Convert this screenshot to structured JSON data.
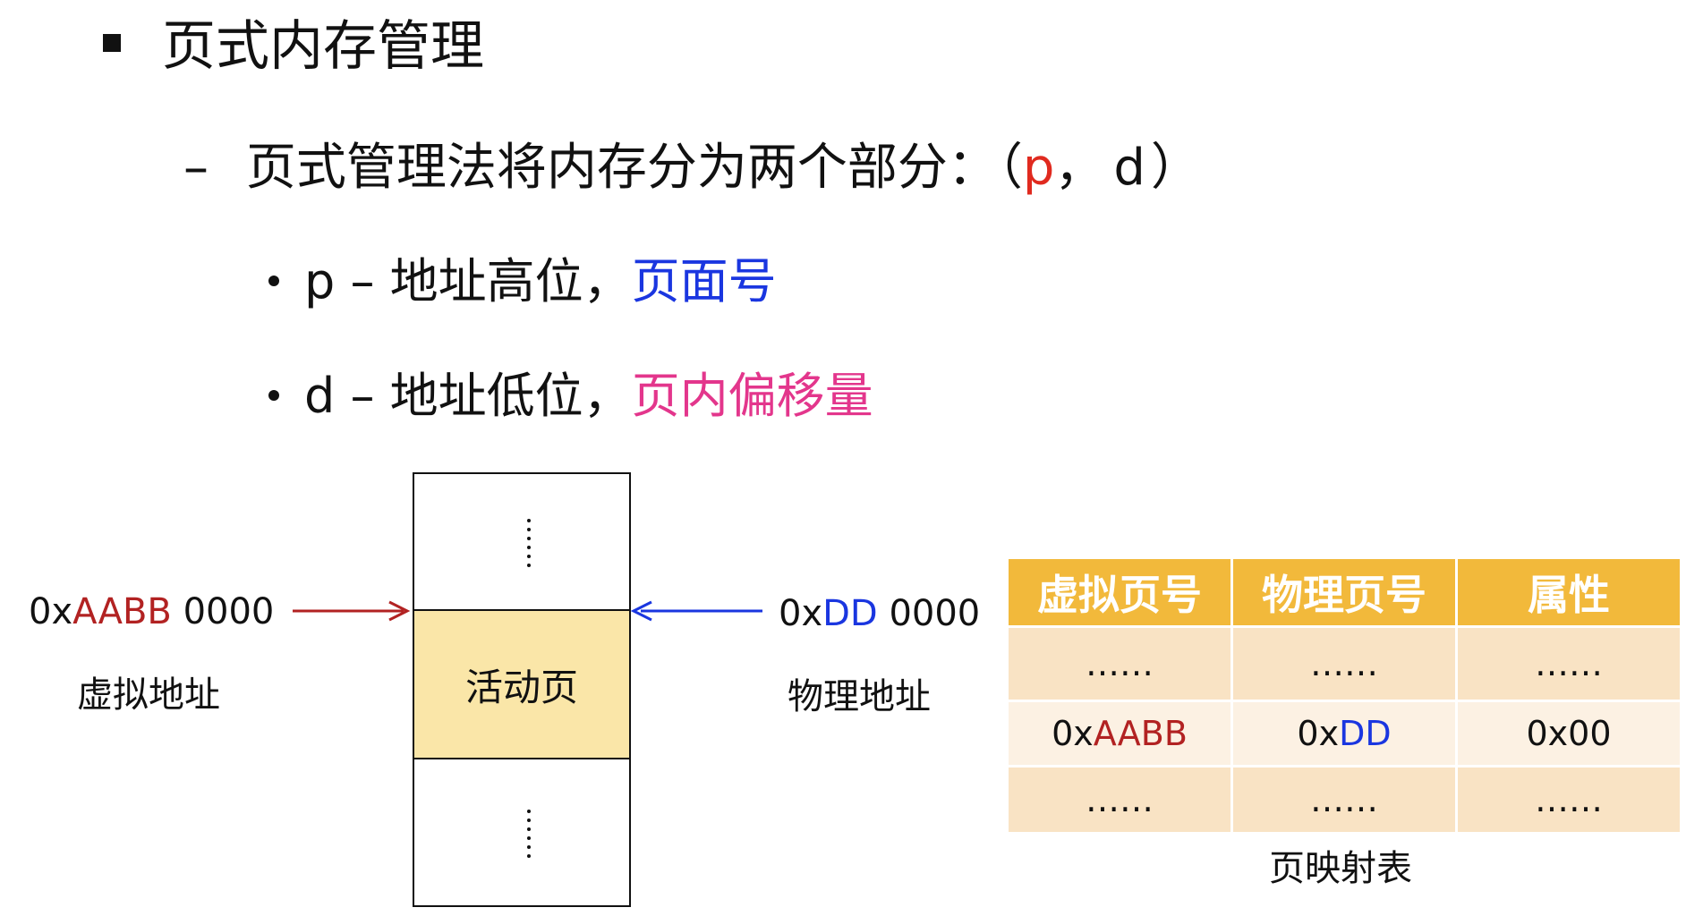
{
  "heading": "页式内存管理",
  "subpoint": {
    "dash": "–",
    "text": "页式管理法将内存分为两个部分：（",
    "p": "p",
    "comma": "，",
    "d": "d",
    "close": "）"
  },
  "bullet_p": {
    "lead": "p – 地址高位，",
    "highlight": "页面号"
  },
  "bullet_d": {
    "lead": "d – 地址低位，",
    "highlight": "页内偏移量"
  },
  "diagram": {
    "active_page": "活动页",
    "virtual": {
      "prefix": "0x",
      "page": "AABB",
      "offset": " 0000",
      "label": "虚拟地址"
    },
    "physical": {
      "prefix": "0x",
      "page": "DD",
      "offset": " 0000",
      "label": "物理地址"
    }
  },
  "page_table": {
    "headers": [
      "虚拟页号",
      "物理页号",
      "属性"
    ],
    "ellipsis": "……",
    "row": {
      "v_prefix": "0x",
      "v_page": "AABB",
      "p_prefix": "0x",
      "p_page": "DD",
      "attr": "0x00"
    },
    "caption": "页映射表"
  },
  "colors": {
    "red": "#e02a1f",
    "blue": "#1a36e0",
    "pink": "#e3368c",
    "table_header": "#f2b93b",
    "active_page": "#fae6a8"
  }
}
